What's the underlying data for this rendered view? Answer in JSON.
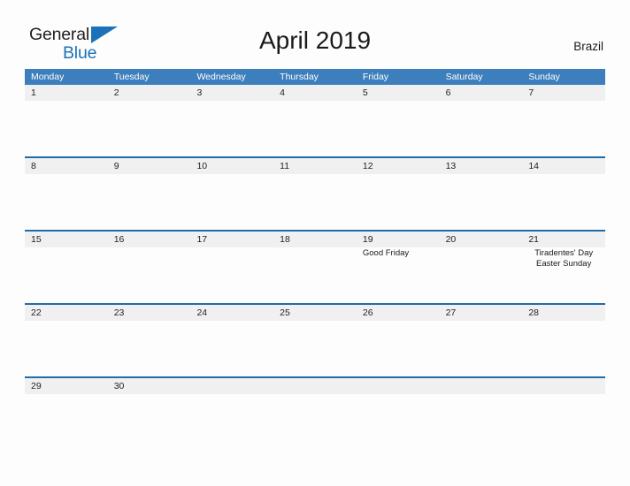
{
  "brand": {
    "name_part1": "General",
    "name_part2": "Blue",
    "triangle_icon": "blue-triangle-icon",
    "color_dark": "#231f20",
    "color_blue": "#1b72b8"
  },
  "header": {
    "title": "April 2019",
    "country": "Brazil"
  },
  "theme": {
    "header_blue": "#3d7ebc",
    "row_rule_blue": "#1f6cab",
    "day_band_gray": "#f0f0f0",
    "page_background": "#fdfdfd"
  },
  "calendar": {
    "month": "April",
    "year": "2019",
    "weekday_headers": [
      "Monday",
      "Tuesday",
      "Wednesday",
      "Thursday",
      "Friday",
      "Saturday",
      "Sunday"
    ],
    "weeks": [
      {
        "days": [
          {
            "date": "1",
            "events": []
          },
          {
            "date": "2",
            "events": []
          },
          {
            "date": "3",
            "events": []
          },
          {
            "date": "4",
            "events": []
          },
          {
            "date": "5",
            "events": []
          },
          {
            "date": "6",
            "events": []
          },
          {
            "date": "7",
            "events": []
          }
        ]
      },
      {
        "days": [
          {
            "date": "8",
            "events": []
          },
          {
            "date": "9",
            "events": []
          },
          {
            "date": "10",
            "events": []
          },
          {
            "date": "11",
            "events": []
          },
          {
            "date": "12",
            "events": []
          },
          {
            "date": "13",
            "events": []
          },
          {
            "date": "14",
            "events": []
          }
        ]
      },
      {
        "days": [
          {
            "date": "15",
            "events": []
          },
          {
            "date": "16",
            "events": []
          },
          {
            "date": "17",
            "events": []
          },
          {
            "date": "18",
            "events": []
          },
          {
            "date": "19",
            "events": [
              "Good Friday"
            ],
            "align": "left"
          },
          {
            "date": "20",
            "events": []
          },
          {
            "date": "21",
            "events": [
              "Tiradentes' Day",
              "Easter Sunday"
            ]
          }
        ]
      },
      {
        "days": [
          {
            "date": "22",
            "events": []
          },
          {
            "date": "23",
            "events": []
          },
          {
            "date": "24",
            "events": []
          },
          {
            "date": "25",
            "events": []
          },
          {
            "date": "26",
            "events": []
          },
          {
            "date": "27",
            "events": []
          },
          {
            "date": "28",
            "events": []
          }
        ]
      },
      {
        "short": true,
        "days": [
          {
            "date": "29",
            "events": []
          },
          {
            "date": "30",
            "events": []
          },
          {
            "date": "",
            "events": []
          },
          {
            "date": "",
            "events": []
          },
          {
            "date": "",
            "events": []
          },
          {
            "date": "",
            "events": []
          },
          {
            "date": "",
            "events": []
          }
        ]
      }
    ]
  }
}
